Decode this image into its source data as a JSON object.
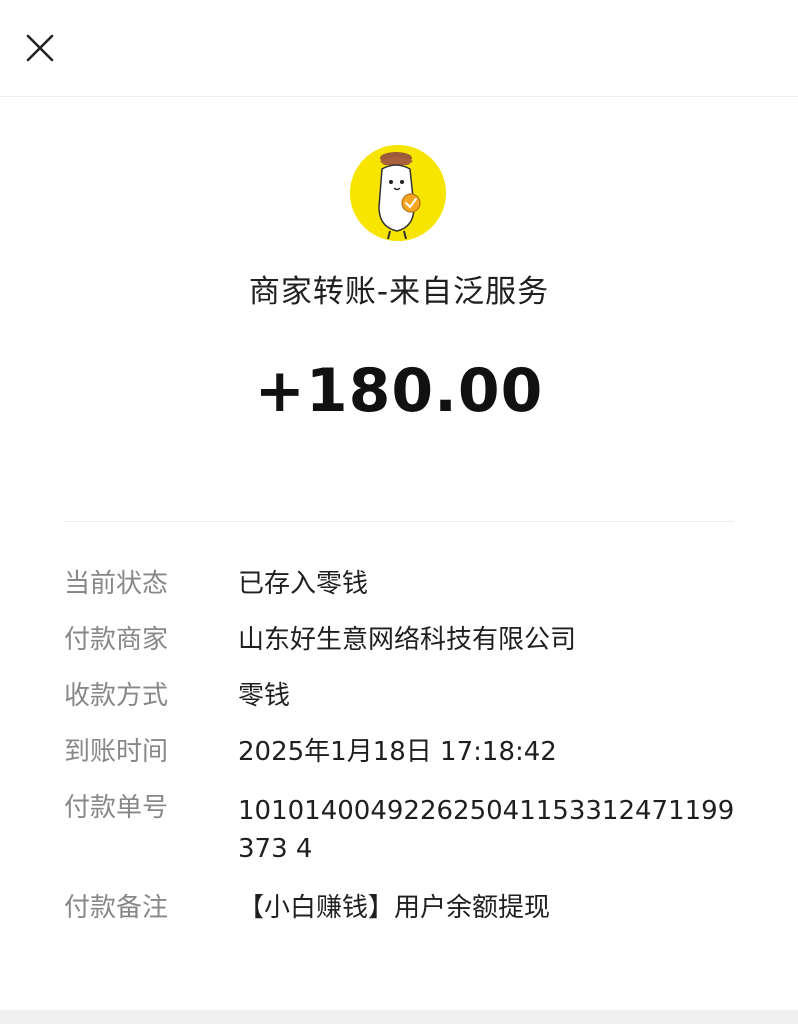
{
  "header": {
    "close_icon": "close-icon"
  },
  "merchant": {
    "avatar_icon": "mascot-avatar",
    "avatar_bg_color": "#f7e500",
    "title": "商家转账-来自泛服务",
    "amount": "+180.00"
  },
  "details": {
    "rows": [
      {
        "label": "当前状态",
        "value": "已存入零钱"
      },
      {
        "label": "付款商家",
        "value": "山东好生意网络科技有限公司"
      },
      {
        "label": "收款方式",
        "value": "零钱"
      },
      {
        "label": "到账时间",
        "value": "2025年1月18日 17:18:42"
      },
      {
        "label": "付款单号",
        "value": "101014004922625041153312471199373 4"
      },
      {
        "label": "付款备注",
        "value": "【小白赚钱】用户余额提现"
      }
    ]
  }
}
